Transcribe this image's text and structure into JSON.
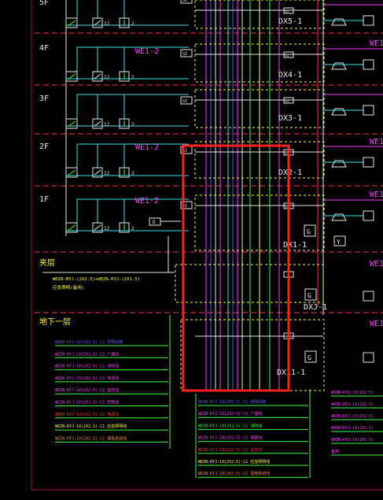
{
  "colors": {
    "background": "#000000",
    "frame": "#b4141e",
    "floor_line": "#ff2e5a",
    "white": "#e8e8e8",
    "yellow": "#ffff3c",
    "green": "#3cff3c",
    "cyan": "#36e6e6",
    "magenta": "#ff3cff",
    "blue": "#5a5aff",
    "red": "#ff3232",
    "orange": "#ff8a3c",
    "highlight": "#ff2020"
  },
  "floors": [
    {
      "label": "5F"
    },
    {
      "label": "4F"
    },
    {
      "label": "3F"
    },
    {
      "label": "2F"
    },
    {
      "label": "1F"
    }
  ],
  "basement": {
    "label_top": "夹层",
    "label_bottom": "地下一层"
  },
  "branch_labels": [
    "WE1-2",
    "WE1-2",
    "WE1-2"
  ],
  "right_labels": [
    "WE1",
    "WE1-",
    "WE1-",
    "WE1-",
    "WE1-"
  ],
  "boxes": [
    "DX5-1",
    "DX4-1",
    "DX3-1",
    "DX2-1",
    "DX1-1",
    "DXJ-1",
    "DX11-1"
  ],
  "device_numbers": [
    "12",
    "2",
    "12",
    "2",
    "12",
    "2",
    "12",
    "2",
    "12",
    "2",
    "12",
    "2",
    "12",
    "2",
    "12",
    "2",
    "12",
    "2"
  ],
  "small_marks": [
    "SI",
    "SI",
    "SI",
    "SI",
    "SI",
    "SI",
    "SI",
    "SI",
    "D",
    "G",
    "G",
    "G",
    "Y",
    "1",
    "1",
    "2",
    "5",
    "6",
    "9",
    "2",
    "Y"
  ],
  "texts": {
    "cable_spec_a": "WDZN-BYJ-(2X2.5)+WDZN-RYJ-(2X1.5)",
    "cable_spec_b": "应急照明(备用)"
  },
  "legend_left": [
    "WDZN-RYJ-1X(2X2.5) C1   照明线路",
    "WDZN-RYJ-1X(2X2.5)-C1   广播线",
    "WDZN-RYJ-1X(2X2.5)-C1   消防线",
    "WDZN-RYJ-1X(2X2.5)-C1   电源线",
    "WDZN-RYJ-1X(2X2.5)-C1   监控线",
    "WDZN-RYJ-1X(2X2.5)-C1   控制线",
    "WDZN-RYJ-1X(2X2.5)-C1   电源线",
    "WDZN-RYJ-1X(2X2.5)-C1   应急照明线",
    "WDZN-RYJ-1X(2X2.5)-C1   弱电系统线"
  ],
  "legend_mid": [
    "WDZN-RYJ-1X(2X2.5) C1   照明线路",
    "WDZN-RYJ-1X(2X2.5)-C1   广播线",
    "WDZN-RYJ-1X(2X2.5) C1   消防线",
    "WDZN-RYJ-1X(2X2.5)-C1   电源线",
    "WDZN-RYJ-1X(2X2.5)-C1   监控线",
    "WDZN-RYJ-1X(2X2.5)-C1   应急照明线",
    "WDZN-RYJ-1X(2X2.5)-C1   弱电系统线"
  ],
  "legend_right": [
    "WDZN-RYJ-1X(2X2.5)",
    "WDZN-RYJ-1X(2X2.5)",
    "WDZN-RYJ-1X(2X2.5)",
    "WDZN-RYJ-1X(2X2.5)",
    "WDZN-RYJ-1X(2X2.5)",
    "备用"
  ]
}
